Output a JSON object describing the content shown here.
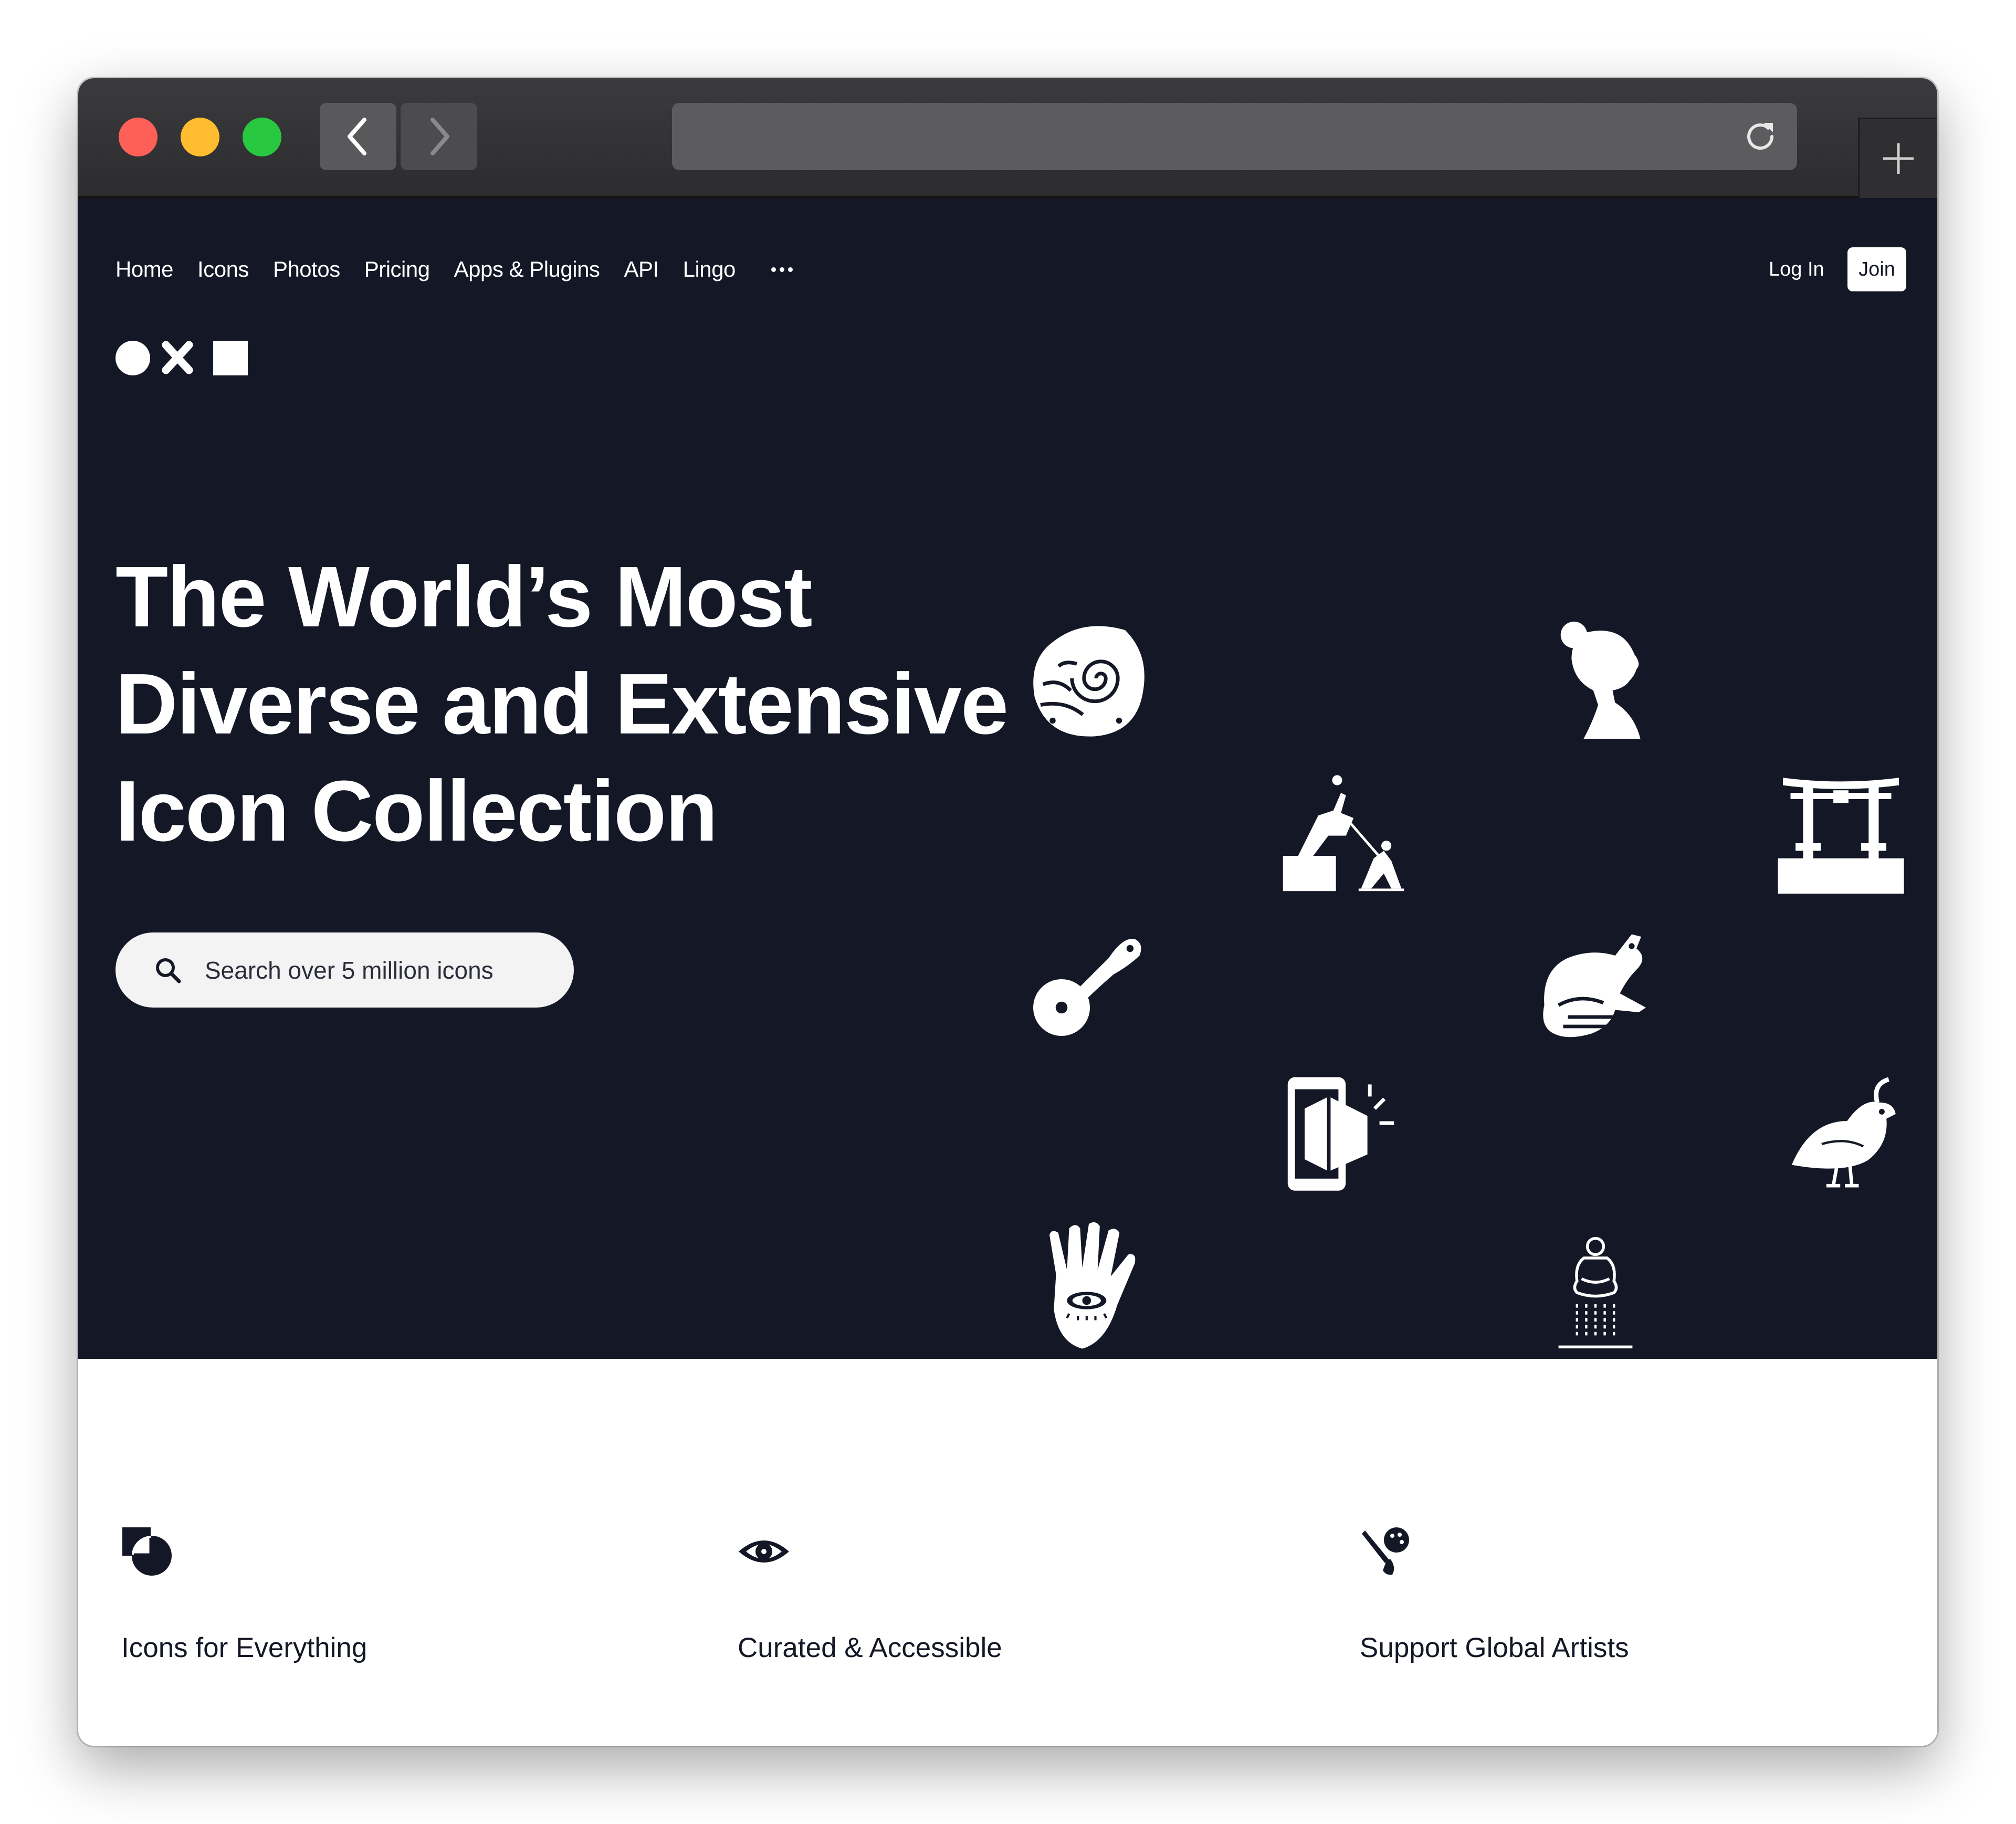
{
  "nav": {
    "items": [
      "Home",
      "Icons",
      "Photos",
      "Pricing",
      "Apps & Plugins",
      "API",
      "Lingo"
    ],
    "more_icon": "ellipsis-icon",
    "login": "Log In",
    "join": "Join"
  },
  "hero": {
    "headline_lines": [
      "The World’s Most",
      "Diverse and Extensive",
      "Icon Collection"
    ],
    "search_placeholder": "Search over 5 million icons",
    "showcase_icons": [
      "fossil-ammonite-icon",
      "girl-profile-icon",
      "toppling-statue-icon",
      "torii-gate-icon",
      "pizza-cutter-icon",
      "frog-icon",
      "phone-box-icon",
      "quail-bird-icon",
      "hamsa-hand-icon",
      "meditation-fountain-icon"
    ]
  },
  "features": [
    {
      "title": "Icons for Everything",
      "icon": "shapes-icon"
    },
    {
      "title": "Curated & Accessible",
      "icon": "eye-icon"
    },
    {
      "title": "Support Global Artists",
      "icon": "brush-palette-icon"
    }
  ],
  "colors": {
    "hero_bg": "#141826",
    "titlebar": "#2c2c2e",
    "traffic_red": "#fe5f57",
    "traffic_yellow": "#febc2e",
    "traffic_green": "#28c840"
  }
}
